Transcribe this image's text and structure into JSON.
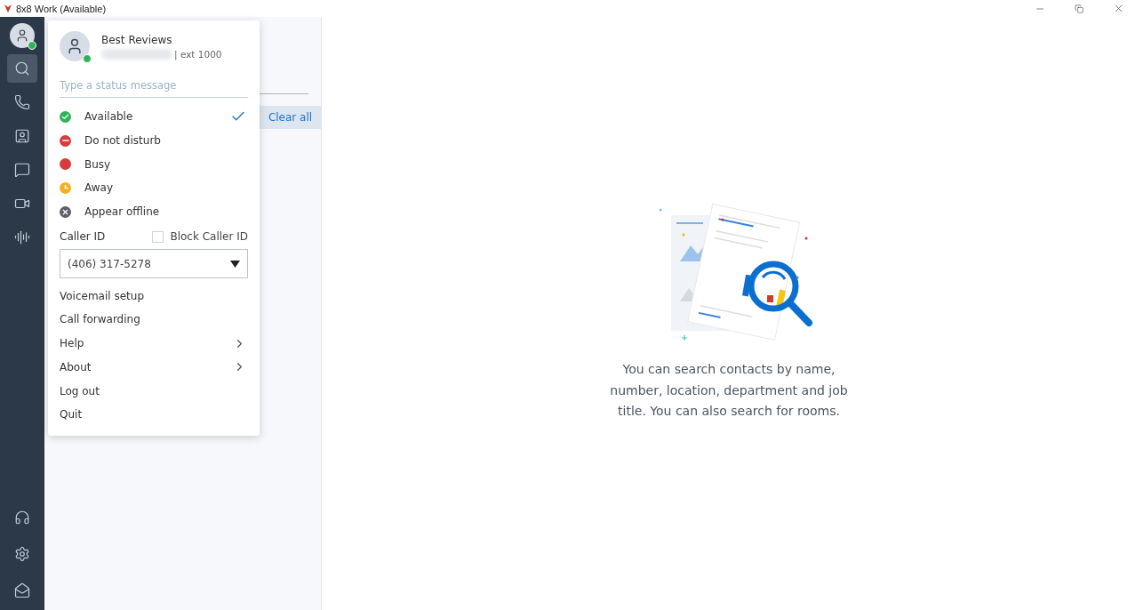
{
  "window": {
    "title": "8x8 Work (Available)"
  },
  "sidebar": {
    "items": [
      {
        "kind": "avatar",
        "selected": false
      },
      {
        "kind": "search",
        "selected": true
      },
      {
        "kind": "phone",
        "selected": false
      },
      {
        "kind": "contacts",
        "selected": false
      },
      {
        "kind": "chat",
        "selected": false
      },
      {
        "kind": "video",
        "selected": false
      },
      {
        "kind": "voice",
        "selected": false
      }
    ],
    "bottom_items": [
      {
        "kind": "headset"
      },
      {
        "kind": "settings"
      },
      {
        "kind": "mail"
      }
    ]
  },
  "search_panel": {
    "clear_button": "Clear all"
  },
  "profile_menu": {
    "name": "Best Reviews",
    "extension": "| ext 1000",
    "status_placeholder": "Type a status message",
    "statuses": [
      {
        "label": "Available",
        "kind": "check",
        "color": "#2fb35a",
        "selected": true
      },
      {
        "label": "Do not disturb",
        "kind": "minus",
        "color": "#d83b3b",
        "selected": false
      },
      {
        "label": "Busy",
        "kind": "dot",
        "color": "#d83b3b",
        "selected": false
      },
      {
        "label": "Away",
        "kind": "clock",
        "color": "#f5b020",
        "selected": false
      },
      {
        "label": "Appear offline",
        "kind": "cross",
        "color": "#5b5f66",
        "selected": false
      }
    ],
    "caller_id_label": "Caller ID",
    "block_caller_id": {
      "label": "Block Caller ID",
      "checked": false
    },
    "caller_id_value": "(406) 317-5278",
    "items": [
      {
        "label": "Voicemail setup",
        "submenu": false
      },
      {
        "label": "Call forwarding",
        "submenu": false
      },
      {
        "label": "Help",
        "submenu": true
      },
      {
        "label": "About",
        "submenu": true
      },
      {
        "label": "Log out",
        "submenu": false
      },
      {
        "label": "Quit",
        "submenu": false
      }
    ]
  },
  "empty_state": {
    "message": "You can search contacts by name, number, location, department and job title. You can also search for rooms."
  }
}
